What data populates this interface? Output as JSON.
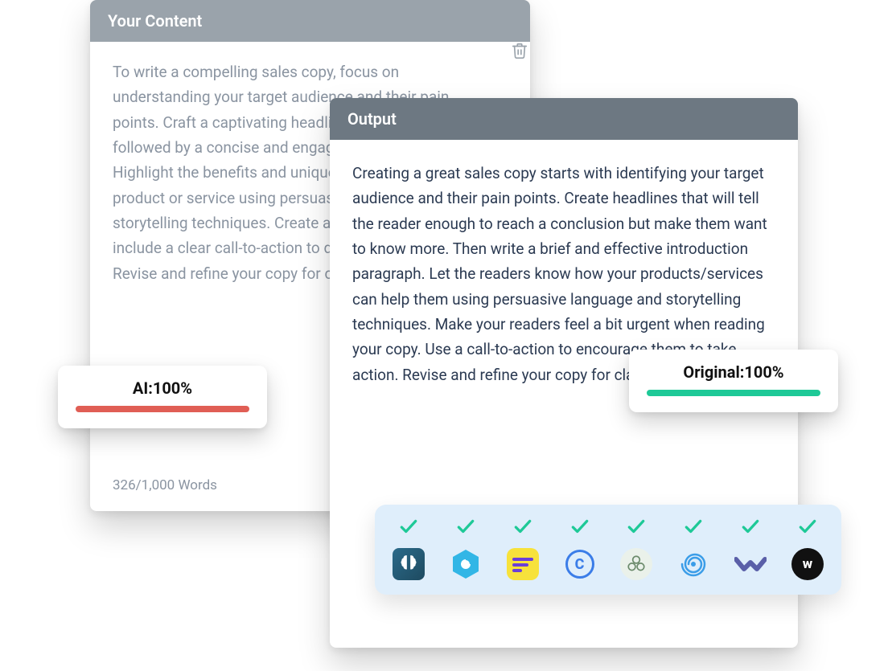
{
  "input": {
    "title": "Your Content",
    "text": "To write a compelling sales copy, focus on understanding your target audience and their pain points. Craft a captivating headline to grab attention, followed by a concise and engaging introduction. Highlight the benefits and unique selling points of your product or service using persuasive language and storytelling techniques. Create a sense of urgency and include a clear call-to-action to drive conversions. Revise and refine your copy for clarity and impact.",
    "word_count": "326/1,000 Words"
  },
  "output": {
    "title": "Output",
    "text": "Creating a great sales copy starts with identifying your target audience and their pain points. Create headlines that will tell the reader enough to reach a conclusion but make them want to know more. Then write a brief and effective introduction paragraph. Let the readers know how your products/services can help them using persuasive language and storytelling techniques. Make your readers feel a bit urgent when reading your copy. Use a call-to-action to encourage them to take action. Revise and refine your copy for clarity and impact."
  },
  "ai_badge": {
    "label": "AI:100%",
    "color": "#e05e55"
  },
  "original_badge": {
    "label": "Original:100%",
    "color": "#1ec997"
  },
  "detectors": [
    {
      "name": "brain-icon",
      "passed": true
    },
    {
      "name": "hex-icon",
      "passed": true
    },
    {
      "name": "bars-icon",
      "passed": true
    },
    {
      "name": "c-ring-icon",
      "passed": true
    },
    {
      "name": "knot-icon",
      "passed": true
    },
    {
      "name": "spiral-icon",
      "passed": true
    },
    {
      "name": "vv-icon",
      "passed": true
    },
    {
      "name": "w-icon",
      "passed": true,
      "letter": "w"
    }
  ]
}
